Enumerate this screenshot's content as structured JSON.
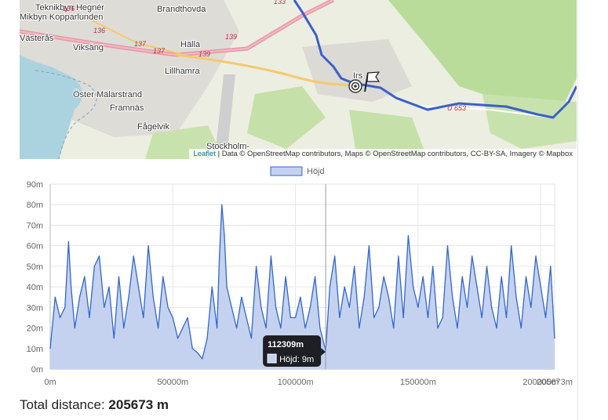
{
  "map": {
    "place_labels": [
      "Teknikbyn Hegnér",
      "Mikbyn Kopparlunden",
      "Västerås",
      "Viksäng",
      "Brandthovda",
      "Hälla",
      "Lillhamra",
      "Öster Mälarstrand",
      "Framnäs",
      "Fågelvik",
      "Stockholm-",
      "Irs"
    ],
    "road_labels": [
      "136",
      "137",
      "137",
      "139",
      "139",
      "U 653",
      "136",
      "133"
    ],
    "attribution": {
      "leaflet": "Leaflet",
      "text": " | Data © OpenStreetMap contributors, Maps © OpenStreetMap contributors, CC-BY-SA, Imagery © Mapbox"
    },
    "colors": {
      "route": "#3a5fcd",
      "water": "#aad3df",
      "forest": "#b9dc9b",
      "urban": "#dcdcdc",
      "road": "#f6c96b"
    },
    "icons": [
      "target-marker-icon",
      "finish-flag-icon"
    ]
  },
  "chart_data": {
    "type": "area",
    "legend": [
      "Höjd"
    ],
    "legend_position": "top-center",
    "x_unit": "m",
    "y_unit": "m",
    "xlim": [
      0,
      205673
    ],
    "ylim": [
      0,
      90
    ],
    "x_ticks": [
      "0m",
      "50000m",
      "100000m",
      "150000m",
      "200000m",
      "205673m"
    ],
    "y_ticks": [
      "0m",
      "10m",
      "20m",
      "30m",
      "40m",
      "50m",
      "60m",
      "70m",
      "80m",
      "90m"
    ],
    "grid": true,
    "colors": {
      "line": "#3366cc",
      "fill": "#c4d2f0"
    },
    "series": [
      {
        "name": "Höjd",
        "x": [
          0,
          2000,
          4000,
          6000,
          7500,
          8500,
          10000,
          12000,
          14000,
          16000,
          18000,
          20000,
          22000,
          24000,
          26000,
          28000,
          30000,
          32000,
          34000,
          36000,
          38000,
          40000,
          42000,
          44000,
          46000,
          48000,
          50000,
          52000,
          54000,
          56000,
          58000,
          60000,
          62000,
          64000,
          66000,
          68000,
          69000,
          70000,
          71000,
          72000,
          74000,
          76000,
          78000,
          80000,
          82000,
          84000,
          86000,
          88000,
          90000,
          92000,
          94000,
          96000,
          98000,
          100000,
          102000,
          104000,
          106000,
          108000,
          110000,
          112309,
          114000,
          116000,
          118000,
          120000,
          122000,
          124000,
          126000,
          128000,
          130000,
          132000,
          134000,
          136000,
          138000,
          140000,
          142000,
          144000,
          146000,
          148000,
          150000,
          152000,
          154000,
          156000,
          158000,
          160000,
          162000,
          164000,
          166000,
          168000,
          170000,
          172000,
          174000,
          176000,
          178000,
          180000,
          182000,
          184000,
          186000,
          188000,
          190000,
          192000,
          194000,
          196000,
          198000,
          200000,
          202000,
          204000,
          205673
        ],
        "y": [
          10,
          35,
          25,
          30,
          62,
          40,
          20,
          35,
          45,
          25,
          50,
          55,
          30,
          40,
          15,
          45,
          20,
          35,
          55,
          40,
          25,
          60,
          35,
          20,
          45,
          30,
          25,
          15,
          20,
          25,
          10,
          8,
          5,
          15,
          40,
          20,
          55,
          80,
          65,
          40,
          30,
          20,
          35,
          25,
          15,
          50,
          30,
          20,
          55,
          30,
          20,
          45,
          25,
          25,
          35,
          20,
          30,
          45,
          20,
          9,
          40,
          55,
          25,
          40,
          30,
          50,
          20,
          35,
          60,
          25,
          30,
          45,
          35,
          20,
          55,
          25,
          65,
          40,
          30,
          45,
          25,
          50,
          20,
          25,
          60,
          35,
          20,
          45,
          30,
          55,
          40,
          25,
          50,
          30,
          20,
          45,
          25,
          60,
          35,
          20,
          45,
          30,
          55,
          40,
          25,
          50,
          15
        ]
      }
    ],
    "tooltip": {
      "title": "112309m",
      "label": "Höjd: 9m",
      "x": 112309
    }
  },
  "summary": {
    "label": "Total distance:",
    "value": "205673 m"
  }
}
